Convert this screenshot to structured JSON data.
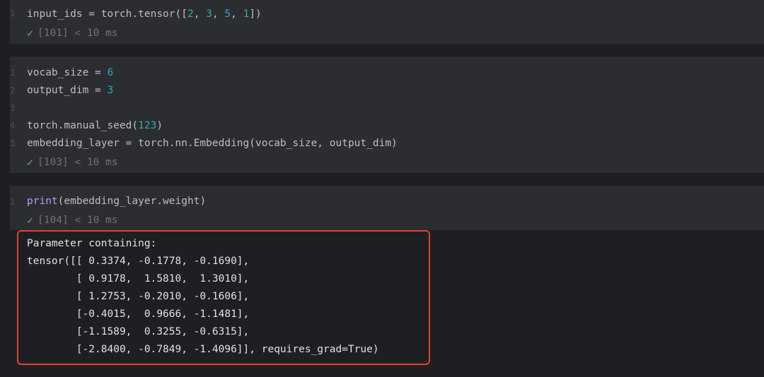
{
  "cells": [
    {
      "line_numbers": [
        "1"
      ],
      "lines": [
        {
          "a": "input_ids = torch.tensor([",
          "n1": "2",
          "s1": ", ",
          "n2": "3",
          "s2": ", ",
          "n3": "5",
          "s3": ", ",
          "n4": "1",
          "b": "])"
        }
      ],
      "exec": "[101] < 10 ms"
    },
    {
      "line_numbers": [
        "1",
        "2",
        "3",
        "4",
        "5"
      ],
      "lines": {
        "l1_a": "vocab_size = ",
        "l1_n": "6",
        "l2_a": "output_dim = ",
        "l2_n": "3",
        "l3": "",
        "l4_a": "torch.manual_seed(",
        "l4_n": "123",
        "l4_b": ")",
        "l5": "embedding_layer = torch.nn.Embedding(vocab_size, output_dim)"
      },
      "exec": "[103] < 10 ms"
    },
    {
      "line_numbers": [
        "1"
      ],
      "lines": {
        "fn": "print",
        "rest": "(embedding_layer.weight)"
      },
      "exec": "[104] < 10 ms"
    }
  ],
  "output": [
    "Parameter containing:",
    "tensor([[ 0.3374, -0.1778, -0.1690],",
    "        [ 0.9178,  1.5810,  1.3010],",
    "        [ 1.2753, -0.2010, -0.1606],",
    "        [-0.4015,  0.9666, -1.1481],",
    "        [-1.1589,  0.3255, -0.6315],",
    "        [-2.8400, -0.7849, -1.4096]], requires_grad=True)"
  ],
  "icons": {
    "exec_status": "check-icon"
  },
  "colors": {
    "number": "#2aacb8",
    "function": "#a9a3f3",
    "check": "#5fb865",
    "highlight_border": "#e0412f"
  }
}
